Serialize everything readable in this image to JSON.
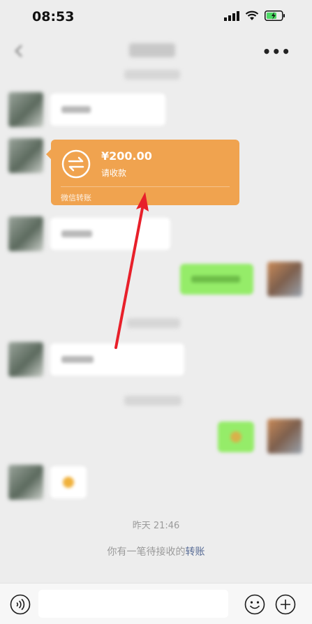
{
  "status_bar": {
    "time": "08:53"
  },
  "nav": {
    "more_label": "•••"
  },
  "transfer_card": {
    "amount": "¥200.00",
    "status": "请收款",
    "footer": "微信转账",
    "accent_color": "#f0a34f"
  },
  "timestamp": "昨天 21:46",
  "system_message": {
    "text": "你有一笔待接收的",
    "link": "转账"
  },
  "icons": [
    "back-icon",
    "more-icon",
    "signal-icon",
    "wifi-icon",
    "battery-icon",
    "transfer-exchange-icon",
    "voice-icon",
    "emoji-icon",
    "plus-icon"
  ]
}
